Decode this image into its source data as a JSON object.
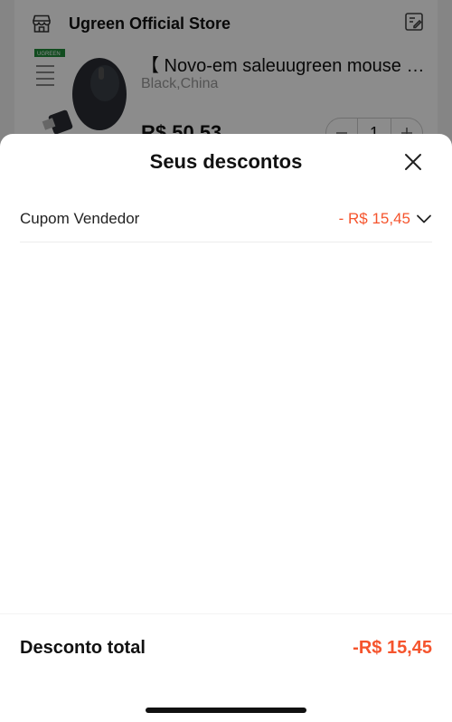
{
  "store": {
    "name": "Ugreen Official Store"
  },
  "product": {
    "title": "【 Novo-em saleuugreen mouse e...",
    "variant": "Black,China",
    "price": "R$ 50,53",
    "quantity": "1",
    "image_brand": "UGREEN"
  },
  "sheet": {
    "title": "Seus descontos",
    "discounts": [
      {
        "label": "Cupom Vendedor",
        "value": "- R$ 15,45"
      }
    ],
    "total_label": "Desconto total",
    "total_value": "-R$ 15,45"
  },
  "colors": {
    "accent": "#f5542d"
  }
}
